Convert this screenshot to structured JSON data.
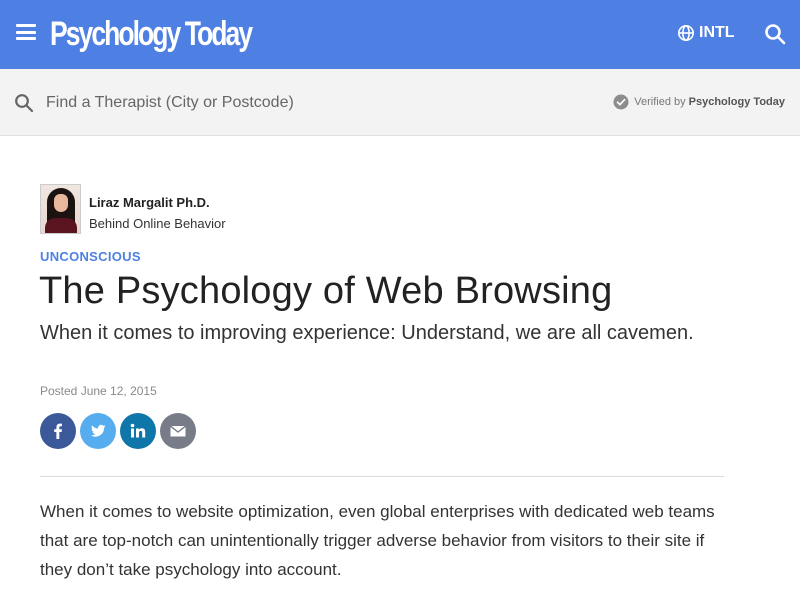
{
  "header": {
    "logo": "Psychology Today",
    "intl_label": "INTL",
    "bg_color": "#4e7fe2",
    "icons": [
      "menu-icon",
      "globe-icon",
      "search-icon"
    ]
  },
  "therapist_search": {
    "placeholder": "Find a Therapist (City or Postcode)",
    "verified_prefix": "Verified by",
    "verified_brand": "Psychology Today",
    "icons": [
      "search-icon",
      "check-circle-icon"
    ]
  },
  "article": {
    "author_name": "Liraz Margalit Ph.D.",
    "blog_name": "Behind Online Behavior",
    "category": "UNCONSCIOUS",
    "title": "The Psychology of Web Browsing",
    "subtitle": "When it comes to improving experience: Understand, we are all cavemen.",
    "posted": "Posted June 12, 2015",
    "body": "When it comes to website optimization, even global enterprises with dedicated web teams that are top-notch can unintentionally trigger adverse behavior from visitors to their site if they don’t take psychology into account."
  },
  "share": [
    {
      "name": "facebook",
      "color": "#3b5998"
    },
    {
      "name": "twitter",
      "color": "#55acee"
    },
    {
      "name": "linkedin",
      "color": "#0e76a8"
    },
    {
      "name": "email",
      "color": "#777c88"
    }
  ],
  "colors": {
    "accent": "#4e7fe2",
    "therapist_bar": "#f3f3f3"
  }
}
